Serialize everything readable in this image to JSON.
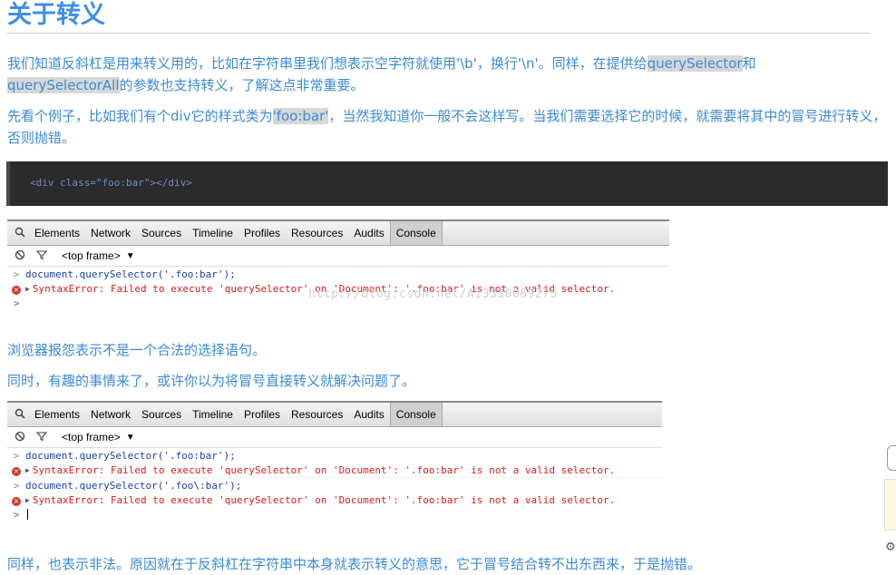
{
  "title": "关于转义",
  "para1": {
    "a": "我们知道反斜杠是用来转义用的，比如在字符串里我们想表示空字符就使用'\\b'，换行'\\n'。同样，在提供给",
    "hl1": "querySelector",
    "b": "和",
    "hl2": "querySelectorAll",
    "c": "的参数也支持转义，了解这点非常重要。"
  },
  "para2": {
    "a": "先看个例子，比如我们有个div它的样式类为",
    "hl": "'foo:bar'",
    "b": "，当然我知道你一般不会这样写。当我们需要选择它的时候，就需要将其中的冒号进行转义，否则抛错。"
  },
  "code": "<div class=\"foo:bar\"></div>",
  "devtools": {
    "tabs": [
      "Elements",
      "Network",
      "Sources",
      "Timeline",
      "Profiles",
      "Resources",
      "Audits",
      "Console"
    ],
    "active_tab": "Console",
    "frame": "<top frame>"
  },
  "console1": {
    "cmd1": "document.querySelector('.foo:bar');",
    "err1": "SyntaxError: Failed to execute 'querySelector' on 'Document': '.foo:bar' is not a valid selector."
  },
  "watermark": "http://blog.csdn.net/Ai3330069275",
  "para3": "浏览器报怨表示不是一个合法的选择语句。",
  "para4": "同时，有趣的事情来了，或许你以为将冒号直接转义就解决问题了。",
  "console2": {
    "cmd1": "document.querySelector('.foo:bar');",
    "err1": "SyntaxError: Failed to execute 'querySelector' on 'Document': '.foo:bar' is not a valid selector.",
    "cmd2": "document.querySelector('.foo\\:bar');",
    "err2": "SyntaxError: Failed to execute 'querySelector' on 'Document': '.foo:bar' is not a valid selector."
  },
  "para5": "同样，也表示非法。原因就在于反斜杠在字符串中本身就表示转义的意思，它于冒号结合转不出东西来，于是抛错。",
  "icons": {
    "search": "search-icon",
    "clear": "clear-console-icon",
    "filter": "filter-icon",
    "error": "error-icon"
  },
  "colors": {
    "text": "#3a8ad8",
    "highlight": "#d7d7d7",
    "code_bg": "#2b2b2b",
    "error": "#e01a1a",
    "command": "#1a3fb0"
  }
}
